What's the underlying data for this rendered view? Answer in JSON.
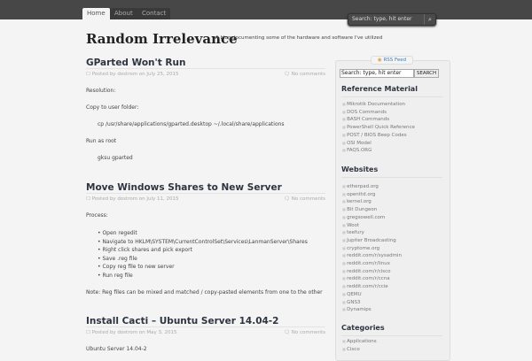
{
  "nav": {
    "tabs": [
      "Home",
      "About",
      "Contact"
    ],
    "search_placeholder": "Search: type, hit enter"
  },
  "site": {
    "title": "Random Irrelevance",
    "tagline": "A blog documenting some of the hardware and software I've utilized"
  },
  "posts": [
    {
      "title": "GParted Won't Run",
      "meta": "Posted by dostrom on July 25, 2015",
      "comments": "No comments",
      "body": [
        "Resolution:",
        "Copy to user folder:",
        "cp /usr/share/applications/gparted.desktop ~/.local/share/applications",
        "Run as root",
        "gksu gparted"
      ]
    },
    {
      "title": "Move Windows Shares to New Server",
      "meta": "Posted by dostrom on July 11, 2015",
      "comments": "No comments",
      "intro": "Process:",
      "steps": [
        "Open regedit",
        "Navigate to HKLM\\SYSTEM\\CurrentControlSet\\Services\\LanmanServer\\Shares",
        "Right click shares and pick export",
        "Save .reg file",
        "Copy reg file to new server",
        "Run reg file"
      ],
      "note": "Note: Reg files can be mixed and matched / copy-pasted elements from one to the other"
    },
    {
      "title": "Install Cacti – Ubuntu Server 14.04-2",
      "meta": "Posted by dostrom on May 3, 2015",
      "comments": "No comments",
      "body": [
        "Ubuntu Server 14.04-2"
      ]
    }
  ],
  "sidebar": {
    "rss": "RSS Feed",
    "search_value": "Search: type, hit enter",
    "search_button": "SEARCH",
    "reference": {
      "heading": "Reference Material",
      "items": [
        "Mikrotik Documentation",
        "DOS Commands",
        "BASH Commands",
        "PowerShell Quick Reference",
        "POST / BIOS Beep Codes",
        "OSI Model",
        "FAQS.ORG"
      ]
    },
    "websites": {
      "heading": "Websites",
      "items": [
        "etherpad.org",
        "openttd.org",
        "kernel.org",
        "Bit Dungeon",
        "gregsowell.com",
        "Woot",
        "teefury",
        "Jupiter Broadcasting",
        "cryptome.org",
        "reddit.com/r/sysadmin",
        "reddit.com/r/linux",
        "reddit.com/r/cisco",
        "reddit.com/r/ccna",
        "reddit.com/r/ccie",
        "QEMU",
        "GNS3",
        "Dynamips"
      ]
    },
    "categories": {
      "heading": "Categories",
      "items": [
        "Applications",
        "Cisco"
      ]
    }
  }
}
